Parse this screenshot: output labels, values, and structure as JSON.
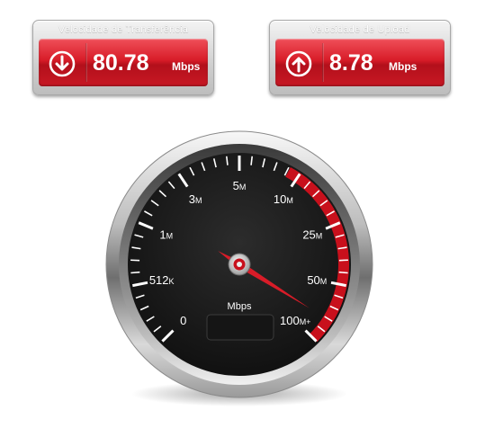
{
  "download": {
    "caption": "Velocidade de Transferência",
    "value": "80.78",
    "unit": "Mbps",
    "icon": "arrow-down-circle-icon"
  },
  "upload": {
    "caption": "Velocidade de Upload",
    "value": "8.78",
    "unit": "Mbps",
    "icon": "arrow-up-circle-icon"
  },
  "gauge": {
    "unit_label": "Mbps",
    "scale": [
      {
        "num": "0",
        "suf": ""
      },
      {
        "num": "512",
        "suf": "K"
      },
      {
        "num": "1",
        "suf": "M"
      },
      {
        "num": "3",
        "suf": "M"
      },
      {
        "num": "5",
        "suf": "M"
      },
      {
        "num": "10",
        "suf": "M"
      },
      {
        "num": "25",
        "suf": "M"
      },
      {
        "num": "50",
        "suf": "M"
      },
      {
        "num": "100",
        "suf": "M+"
      }
    ],
    "needle_reading": "80.78",
    "colors": {
      "red_zone": "#c8101c",
      "face": "#1b1b1b",
      "accent_red": "#d81c28"
    }
  }
}
